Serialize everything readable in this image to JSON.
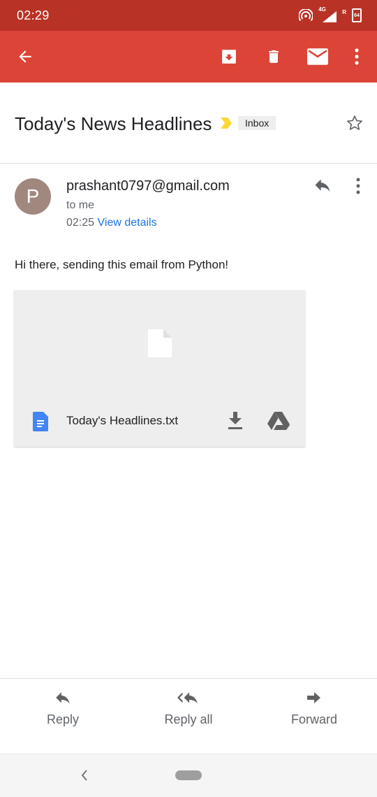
{
  "status_bar": {
    "time": "02:29",
    "network": "4G",
    "roaming": "R",
    "battery": "64"
  },
  "toolbar": {
    "icons": [
      "arrow-back-icon",
      "archive-icon",
      "delete-icon",
      "mail-icon",
      "more-vert-icon"
    ]
  },
  "email": {
    "subject": "Today's News Headlines",
    "label": "Inbox",
    "sender_initial": "P",
    "sender": "prashant0797@gmail.com",
    "recipient": "to me",
    "time": "02:25",
    "view_details": "View details",
    "body": "Hi there, sending this email from Python!"
  },
  "attachment": {
    "filename": "Today's Headlines.txt"
  },
  "actions": {
    "reply": "Reply",
    "reply_all": "Reply all",
    "forward": "Forward"
  },
  "colors": {
    "status_bar": "#b93226",
    "app_bar": "#db4437",
    "link": "#1a73e8",
    "avatar": "#a1887f",
    "importance": "#fdd835",
    "doc_icon": "#4285f4"
  }
}
